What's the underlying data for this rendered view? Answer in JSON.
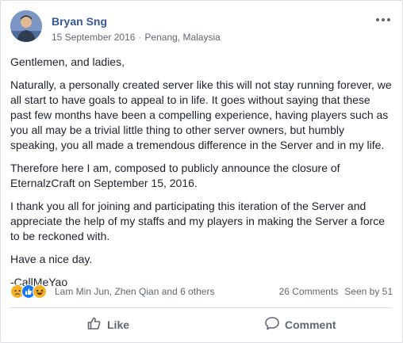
{
  "post": {
    "author": "Bryan Sng",
    "date": "15 September 2016",
    "separator": "·",
    "location": "Penang, Malaysia",
    "more_icon": "more-options-icon",
    "paragraphs": [
      "Gentlemen, and ladies,",
      "Naturally, a personally created server like this will not stay running forever, we all start to have goals to appeal to in life. It goes without saying that these past few months have been a compelling experience, having players such as you all may be a trivial little thing to other server owners, but humbly speaking, you all made a tremendous difference in the Server and in my life.",
      "Therefore here I am, composed to publicly announce the closure of EternalzCraft on September 15, 2016.",
      "I thank you all for joining and participating this iteration of the Server and appreciate the help of my staffs and my players in making the Server a force to be reckoned with.",
      "Have a nice day.",
      "-CallMeYao"
    ]
  },
  "reactions": {
    "icons": [
      "sad-reaction-icon",
      "like-reaction-icon",
      "haha-reaction-icon"
    ],
    "names": "Lam Min Jun, Zhen Qian and 6 others",
    "comments": "26 Comments",
    "seen": "Seen by 51"
  },
  "actions": {
    "like_label": "Like",
    "comment_label": "Comment"
  },
  "colors": {
    "name_blue": "#365899",
    "like_blue": "#1877f2",
    "emoji_yellow": "#f7b125"
  }
}
